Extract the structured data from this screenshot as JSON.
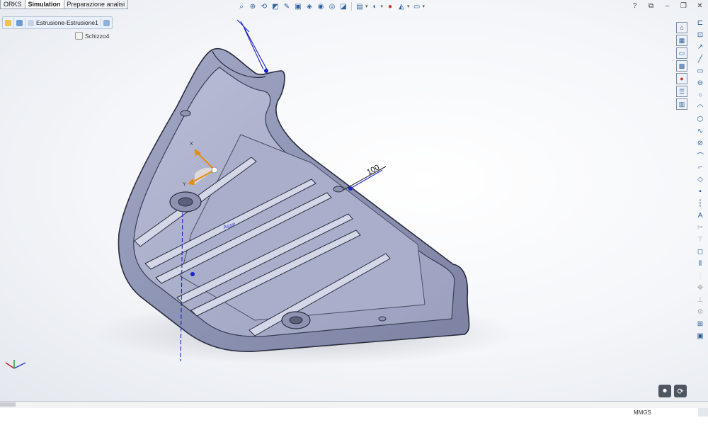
{
  "tabs": [
    {
      "label": "ORKS",
      "active": false
    },
    {
      "label": "Simulation",
      "active": true
    },
    {
      "label": "Preparazione analisi",
      "active": false
    }
  ],
  "breadcrumb": {
    "items": [
      "Estrusione-Estrusione1"
    ],
    "child": "Schizzo4"
  },
  "model": {
    "dimension": "100",
    "axis_x_label": "X",
    "axis_y_label": "Y",
    "sketch_hint": "Asse"
  },
  "statusbar": {
    "units": "MMGS"
  },
  "hud_icons": [
    "zoom-to-fit-icon",
    "zoom-area-icon",
    "previous-view-icon",
    "section-view-icon",
    "dynamic-annotation-icon",
    "view-orientation-icon",
    "display-style-icon",
    "hide-show-icon",
    "edit-appearance-icon",
    "apply-scene-icon",
    "view-settings-icon",
    "display-icon"
  ],
  "colors": {
    "part_body": "#8d93b5",
    "part_edge": "#2a2d3f",
    "sketch_blue": "#1a22c8",
    "triad_orange": "#e98a10"
  }
}
